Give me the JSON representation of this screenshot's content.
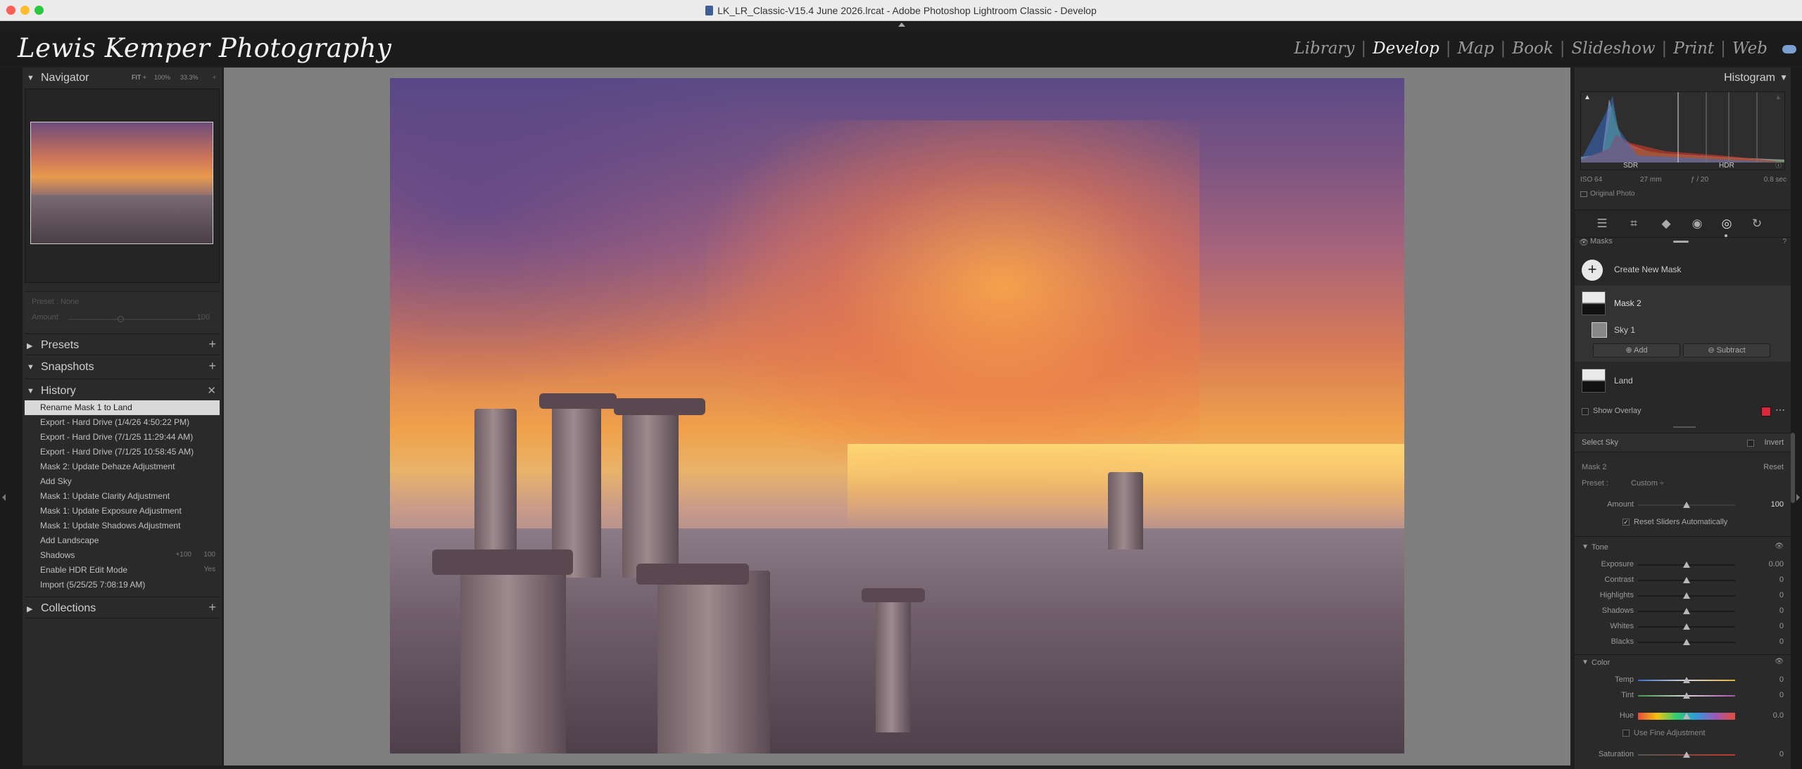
{
  "window": {
    "title": "LK_LR_Classic-V15.4 June  2026.lrcat - Adobe Photoshop Lightroom Classic - Develop"
  },
  "identity_plate": "Lewis Kemper Photography",
  "modules": [
    "Library",
    "Develop",
    "Map",
    "Book",
    "Slideshow",
    "Print",
    "Web"
  ],
  "active_module": "Develop",
  "left_panel": {
    "navigator": {
      "title": "Navigator",
      "zoom_options": [
        "FIT ÷",
        "100%",
        "33.3%",
        "÷"
      ]
    },
    "preset_amount": {
      "preset_label": "Preset : None",
      "amount_label": "Amount",
      "amount_value": "100"
    },
    "presets_title": "Presets",
    "snapshots_title": "Snapshots",
    "history_title": "History",
    "history_items": [
      {
        "label": "Rename Mask 1 to Land",
        "v1": "",
        "v2": ""
      },
      {
        "label": "Export - Hard Drive (1/4/26 4:50:22 PM)",
        "v1": "",
        "v2": ""
      },
      {
        "label": "Export - Hard Drive (7/1/25 11:29:44 AM)",
        "v1": "",
        "v2": ""
      },
      {
        "label": "Export - Hard Drive (7/1/25 10:58:45 AM)",
        "v1": "",
        "v2": ""
      },
      {
        "label": "Mask 2: Update Dehaze Adjustment",
        "v1": "",
        "v2": ""
      },
      {
        "label": "Add Sky",
        "v1": "",
        "v2": ""
      },
      {
        "label": "Mask 1: Update Clarity Adjustment",
        "v1": "",
        "v2": ""
      },
      {
        "label": "Mask 1: Update Exposure Adjustment",
        "v1": "",
        "v2": ""
      },
      {
        "label": "Mask 1: Update Shadows Adjustment",
        "v1": "",
        "v2": ""
      },
      {
        "label": "Add Landscape",
        "v1": "",
        "v2": ""
      },
      {
        "label": "Shadows",
        "v1": "+100",
        "v2": "100"
      },
      {
        "label": "Enable HDR Edit Mode",
        "v1": "",
        "v2": "Yes"
      },
      {
        "label": "Import (5/25/25 7:08:19 AM)",
        "v1": "",
        "v2": ""
      }
    ],
    "collections_title": "Collections"
  },
  "right_panel": {
    "histogram_title": "Histogram",
    "hist_labels": {
      "sdr": "SDR",
      "hdr": "HDR"
    },
    "exif": {
      "iso": "ISO 64",
      "focal": "27 mm",
      "aperture": "ƒ / 20",
      "shutter": "0.8 sec"
    },
    "original_photo_label": "Original Photo",
    "masks": {
      "title": "Masks",
      "create_new": "Create New Mask",
      "mask2": "Mask 2",
      "sky1": "Sky 1",
      "add_label": "Add",
      "subtract_label": "Subtract",
      "land": "Land",
      "show_overlay": "Show Overlay",
      "overlay_color": "#d9283a"
    },
    "select_sky": "Select Sky",
    "invert": "Invert",
    "mask_name": "Mask 2",
    "reset": "Reset",
    "preset_label": "Preset :",
    "preset_value": "Custom ÷",
    "amount_label": "Amount",
    "amount_value": "100",
    "reset_sliders": "Reset Sliders Automatically",
    "tone_title": "Tone",
    "tone": [
      {
        "label": "Exposure",
        "value": "0.00",
        "pos": 0.5
      },
      {
        "label": "Contrast",
        "value": "0",
        "pos": 0.5
      },
      {
        "label": "Highlights",
        "value": "0",
        "pos": 0.5
      },
      {
        "label": "Shadows",
        "value": "0",
        "pos": 0.5
      },
      {
        "label": "Whites",
        "value": "0",
        "pos": 0.5
      },
      {
        "label": "Blacks",
        "value": "0",
        "pos": 0.5
      }
    ],
    "color_title": "Color",
    "color": [
      {
        "label": "Temp",
        "value": "0",
        "pos": 0.5
      },
      {
        "label": "Tint",
        "value": "0",
        "pos": 0.5
      }
    ],
    "hue_label": "Hue",
    "hue_value": "0.0",
    "fine_adjust": "Use Fine Adjustment",
    "saturation_label": "Saturation",
    "saturation_value": "0"
  }
}
